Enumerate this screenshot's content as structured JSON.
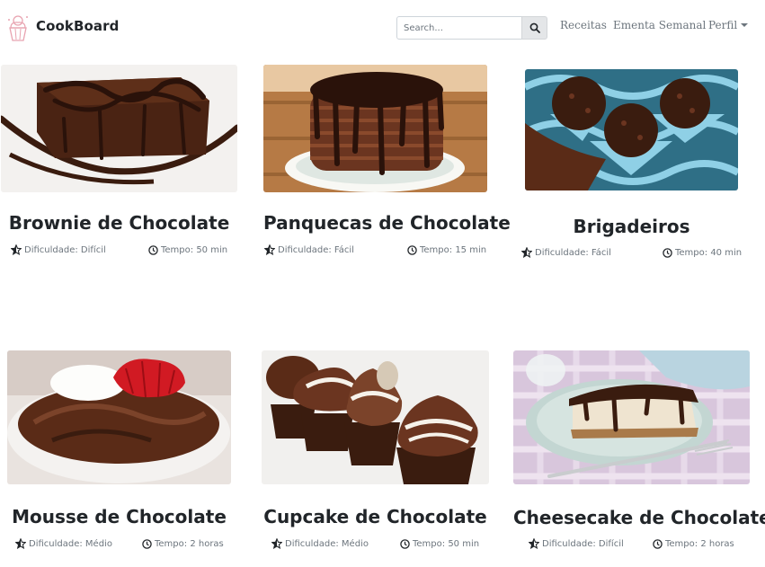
{
  "brand": {
    "name": "CookBoard",
    "logo_icon": "cupcake-logo-icon"
  },
  "search": {
    "placeholder": "Search...",
    "button_icon": "search-icon"
  },
  "nav": {
    "recipes": "Receitas",
    "weekly_menu": "Ementa Semanal",
    "profile": "Perfil"
  },
  "recipes": [
    {
      "title": "Brownie de Chocolate",
      "difficulty": "Dificuldade: Difícil",
      "time": "Tempo: 50 min"
    },
    {
      "title": "Panquecas de Chocolate",
      "difficulty": "Dificuldade: Fácil",
      "time": "Tempo: 15 min"
    },
    {
      "title": "Brigadeiros",
      "difficulty": "Dificuldade: Fácil",
      "time": "Tempo: 40 min"
    },
    {
      "title": "Mousse de Chocolate",
      "difficulty": "Dificuldade: Médio",
      "time": "Tempo: 2 horas"
    },
    {
      "title": "Cupcake de Chocolate",
      "difficulty": "Dificuldade: Médio",
      "time": "Tempo: 50 min"
    },
    {
      "title": "Cheesecake de Chocolate",
      "difficulty": "Dificuldade: Difícil",
      "time": "Tempo: 2 horas"
    }
  ],
  "icons": {
    "difficulty": "star-half-icon",
    "time": "clock-icon"
  },
  "colors": {
    "text": "#212529",
    "muted": "#6c757d",
    "chocolate": "#4a2313"
  }
}
